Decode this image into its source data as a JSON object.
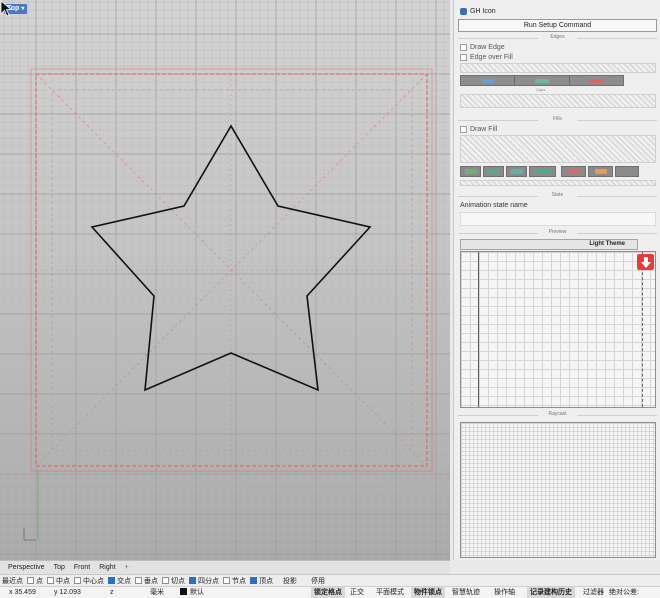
{
  "viewport": {
    "name": "Top",
    "tabs": [
      "Perspective",
      "Top",
      "Front",
      "Right"
    ],
    "tab_add": "+"
  },
  "panel": {
    "title": "GH Icon",
    "run_button": "Run Setup Command",
    "edges": {
      "section": "Edges",
      "draw_edge": "Draw Edge",
      "edge_over_fill": "Edge over Fill",
      "caps_label": "Caps"
    },
    "fills": {
      "section": "Fills",
      "draw_fill": "Draw Fill"
    },
    "state": {
      "section": "State",
      "anim_label": "Animation state name"
    },
    "preview": {
      "section": "Preview",
      "theme_button": "Light Theme"
    },
    "raycast": {
      "section": "Raycast"
    }
  },
  "snaps": [
    {
      "label": "最近点",
      "on": false,
      "box": false
    },
    {
      "label": "点",
      "on": false,
      "box": true
    },
    {
      "label": "中点",
      "on": false,
      "box": true
    },
    {
      "label": "中心点",
      "on": false,
      "box": true
    },
    {
      "label": "交点",
      "on": true,
      "box": true
    },
    {
      "label": "垂点",
      "on": false,
      "box": true
    },
    {
      "label": "切点",
      "on": false,
      "box": true
    },
    {
      "label": "四分点",
      "on": true,
      "box": true
    },
    {
      "label": "节点",
      "on": false,
      "box": true
    },
    {
      "label": "顶点",
      "on": true,
      "box": true
    },
    {
      "label": "投影",
      "on": false,
      "box": false
    },
    {
      "label": "停用",
      "on": false,
      "box": false
    }
  ],
  "status": {
    "x": "x 35.459",
    "y": "y 12.093",
    "z": "z",
    "unit": "毫米",
    "layer": "默认",
    "toggles": [
      {
        "label": "锁定格点",
        "bold": true
      },
      {
        "label": "正交",
        "bold": false
      },
      {
        "label": "平面模式",
        "bold": false
      },
      {
        "label": "物件锁点",
        "bold": true
      },
      {
        "label": "智慧轨迹",
        "bold": false
      },
      {
        "label": "操作轴",
        "bold": false
      },
      {
        "label": "记录建构历史",
        "bold": true
      },
      {
        "label": "过滤器",
        "bold": false
      },
      {
        "label": "绝对公差: 0.001",
        "bold": false
      }
    ]
  },
  "colors": {
    "edge_swatches": [
      "#6f9fc9",
      "#6fb8a0",
      "#d36a6a"
    ],
    "fill_swatches": [
      "#6fae78",
      "#58a987",
      "#5fb3a5",
      "#4ea896",
      "#d86a6a",
      "#e39b55",
      "#8a8a8a"
    ],
    "star_stroke": "#111111",
    "bounds_red": "#e85a5a",
    "download_red": "#e83b3b"
  },
  "icons": [
    "gh-icon",
    "mouse-cursor-icon",
    "download-arrow-icon",
    "axis-icon"
  ]
}
